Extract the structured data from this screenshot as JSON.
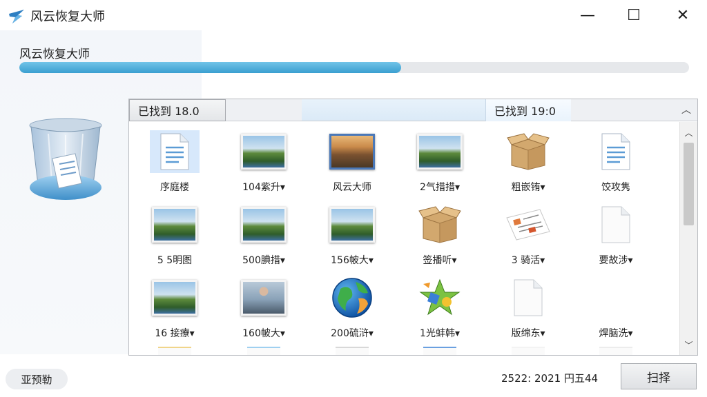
{
  "window": {
    "title": "风云恢复大师",
    "minimize": "—",
    "maximize": "☐",
    "close": "✕"
  },
  "main": {
    "heading": "风云恢复大师",
    "progress": 0.57
  },
  "tabs": {
    "left": "已找到 18.0",
    "right": "已找到 19:0",
    "collapse": "︿"
  },
  "files": [
    {
      "label": "序庭楼",
      "icon": "document-icon"
    },
    {
      "label": "104紫升▾",
      "icon": "landscape-photo-icon"
    },
    {
      "label": "风云大师",
      "icon": "city-photo-icon"
    },
    {
      "label": "2气措措▾",
      "icon": "landscape-photo-icon"
    },
    {
      "label": "粗嵌铕▾",
      "icon": "box-icon"
    },
    {
      "label": "饺攻隽",
      "icon": "document-icon"
    },
    {
      "label": "5 5明图",
      "icon": "landscape-photo-icon"
    },
    {
      "label": "500腆措▾",
      "icon": "landscape-photo-icon"
    },
    {
      "label": "156帔大▾",
      "icon": "landscape-photo-icon"
    },
    {
      "label": "签播听▾",
      "icon": "box-icon"
    },
    {
      "label": "3 骑活▾",
      "icon": "paper-sheet-icon"
    },
    {
      "label": "要故涉▾",
      "icon": "blank-file-icon"
    },
    {
      "label": "16 接療▾",
      "icon": "landscape-photo-icon"
    },
    {
      "label": "160帔大▾",
      "icon": "person-photo-icon"
    },
    {
      "label": "200硫浒▾",
      "icon": "globe-icon"
    },
    {
      "label": "1光蚌韩▾",
      "icon": "star-app-icon"
    },
    {
      "label": "版绵东▾",
      "icon": "blank-file-icon"
    },
    {
      "label": "焊脑洗▾",
      "icon": "none"
    }
  ],
  "scrollbar": {
    "up": "︿",
    "down": "﹀"
  },
  "footer": {
    "left_button": "亚预勒",
    "status": "2522:  2021 円五44",
    "scan_button": "扫择"
  },
  "colors": {
    "progress_fill": "#3a9fd0",
    "accent": "#4a90d0"
  }
}
